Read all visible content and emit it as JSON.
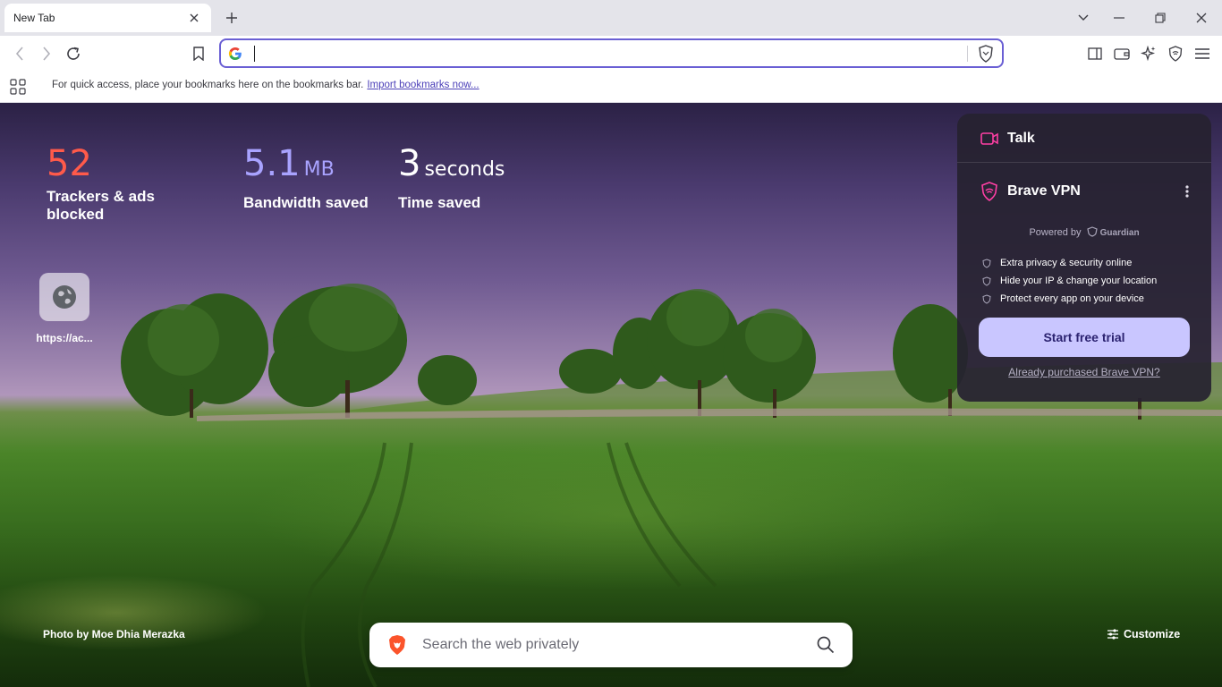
{
  "tab": {
    "title": "New Tab"
  },
  "omnibox": {
    "value": ""
  },
  "bookmarks_bar": {
    "message": "For quick access, place your bookmarks here on the bookmarks bar.",
    "import_link": "Import bookmarks now..."
  },
  "stats": [
    {
      "value": "52",
      "unit": "",
      "label": "Trackers & ads blocked"
    },
    {
      "value": "5.1",
      "unit": "MB",
      "label": "Bandwidth saved"
    },
    {
      "value": "3",
      "unit": "seconds",
      "label": "Time saved"
    }
  ],
  "top_site": {
    "label": "https://ac..."
  },
  "widget": {
    "talk_label": "Talk",
    "vpn_label": "Brave VPN",
    "powered_by": "Powered by",
    "powered_brand": "Guardian",
    "features": [
      "Extra privacy & security online",
      "Hide your IP & change your location",
      "Protect every app on your device"
    ],
    "cta_label": "Start free trial",
    "purchased_link": "Already purchased Brave VPN?"
  },
  "photo_credit": "Photo by Moe Dhia Merazka",
  "search": {
    "placeholder": "Search the web privately"
  },
  "customize_label": "Customize",
  "colors": {
    "accent": "#6a5fd4",
    "trackers": "#ff5a4a",
    "bandwidth": "#a9a3ff",
    "cta_bg": "#c9c6ff",
    "talk_icon": "#ff3fa4"
  }
}
